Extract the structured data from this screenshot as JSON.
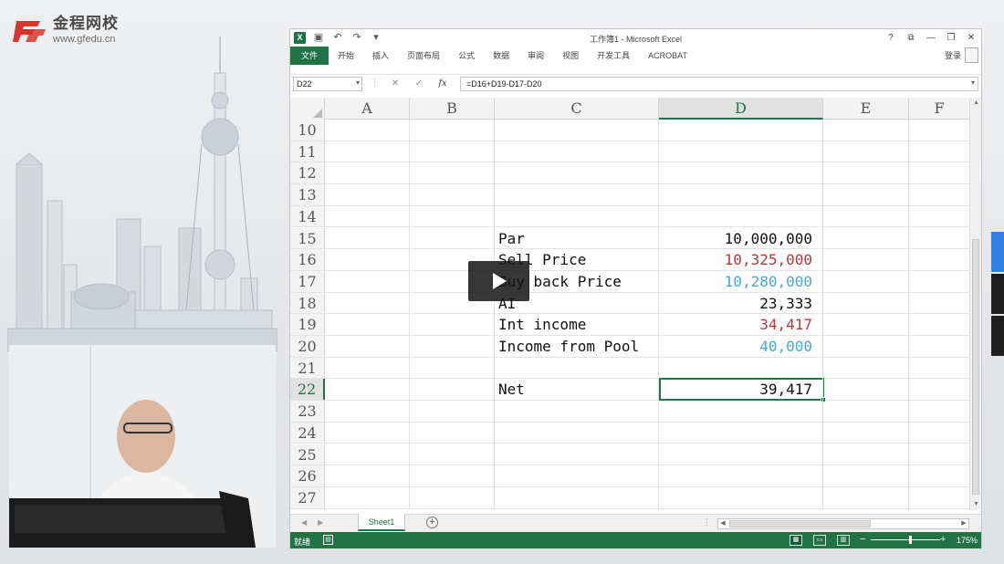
{
  "brand": {
    "name": "金程网校",
    "url": "www.gfedu.cn",
    "logo_color": "#d9342b"
  },
  "excel": {
    "title": "工作簿1 - Microsoft Excel",
    "window_controls": [
      "?",
      "⧉",
      "—",
      "❐",
      "✕"
    ],
    "ribbon_tabs": [
      "文件",
      "开始",
      "插入",
      "页面布局",
      "公式",
      "数据",
      "审阅",
      "视图",
      "开发工具",
      "ACROBAT"
    ],
    "login": "登录",
    "name_box": "D22",
    "formula": "=D16+D19-D17-D20",
    "columns": [
      "A",
      "B",
      "C",
      "D",
      "E",
      "F"
    ],
    "selected_column": "D",
    "selected_row": "22",
    "rows": [
      {
        "num": "10",
        "label": "",
        "value": "",
        "color": ""
      },
      {
        "num": "11",
        "label": "",
        "value": "",
        "color": ""
      },
      {
        "num": "12",
        "label": "",
        "value": "",
        "color": ""
      },
      {
        "num": "13",
        "label": "",
        "value": "",
        "color": ""
      },
      {
        "num": "14",
        "label": "",
        "value": "",
        "color": ""
      },
      {
        "num": "15",
        "label": "Par",
        "value": "10,000,000",
        "color": "#111111"
      },
      {
        "num": "16",
        "label": "Sell Price",
        "value": "10,325,000",
        "color": "#b03a3a"
      },
      {
        "num": "17",
        "label": "Buy back Price",
        "value": "10,280,000",
        "color": "#4aa8c8"
      },
      {
        "num": "18",
        "label": "AI",
        "value": "23,333",
        "color": "#111111"
      },
      {
        "num": "19",
        "label": "Int income",
        "value": "34,417",
        "color": "#b03a3a"
      },
      {
        "num": "20",
        "label": "Income from Pool",
        "value": "40,000",
        "color": "#4aa8c8"
      },
      {
        "num": "21",
        "label": "",
        "value": "",
        "color": ""
      },
      {
        "num": "22",
        "label": "Net",
        "value": "39,417",
        "color": "#111111"
      },
      {
        "num": "23",
        "label": "",
        "value": "",
        "color": ""
      },
      {
        "num": "24",
        "label": "",
        "value": "",
        "color": ""
      },
      {
        "num": "25",
        "label": "",
        "value": "",
        "color": ""
      },
      {
        "num": "26",
        "label": "",
        "value": "",
        "color": ""
      },
      {
        "num": "27",
        "label": "",
        "value": "",
        "color": ""
      }
    ],
    "sheet_tab": "Sheet1",
    "status": "就绪",
    "zoom": "175%",
    "accent": "#217346"
  }
}
